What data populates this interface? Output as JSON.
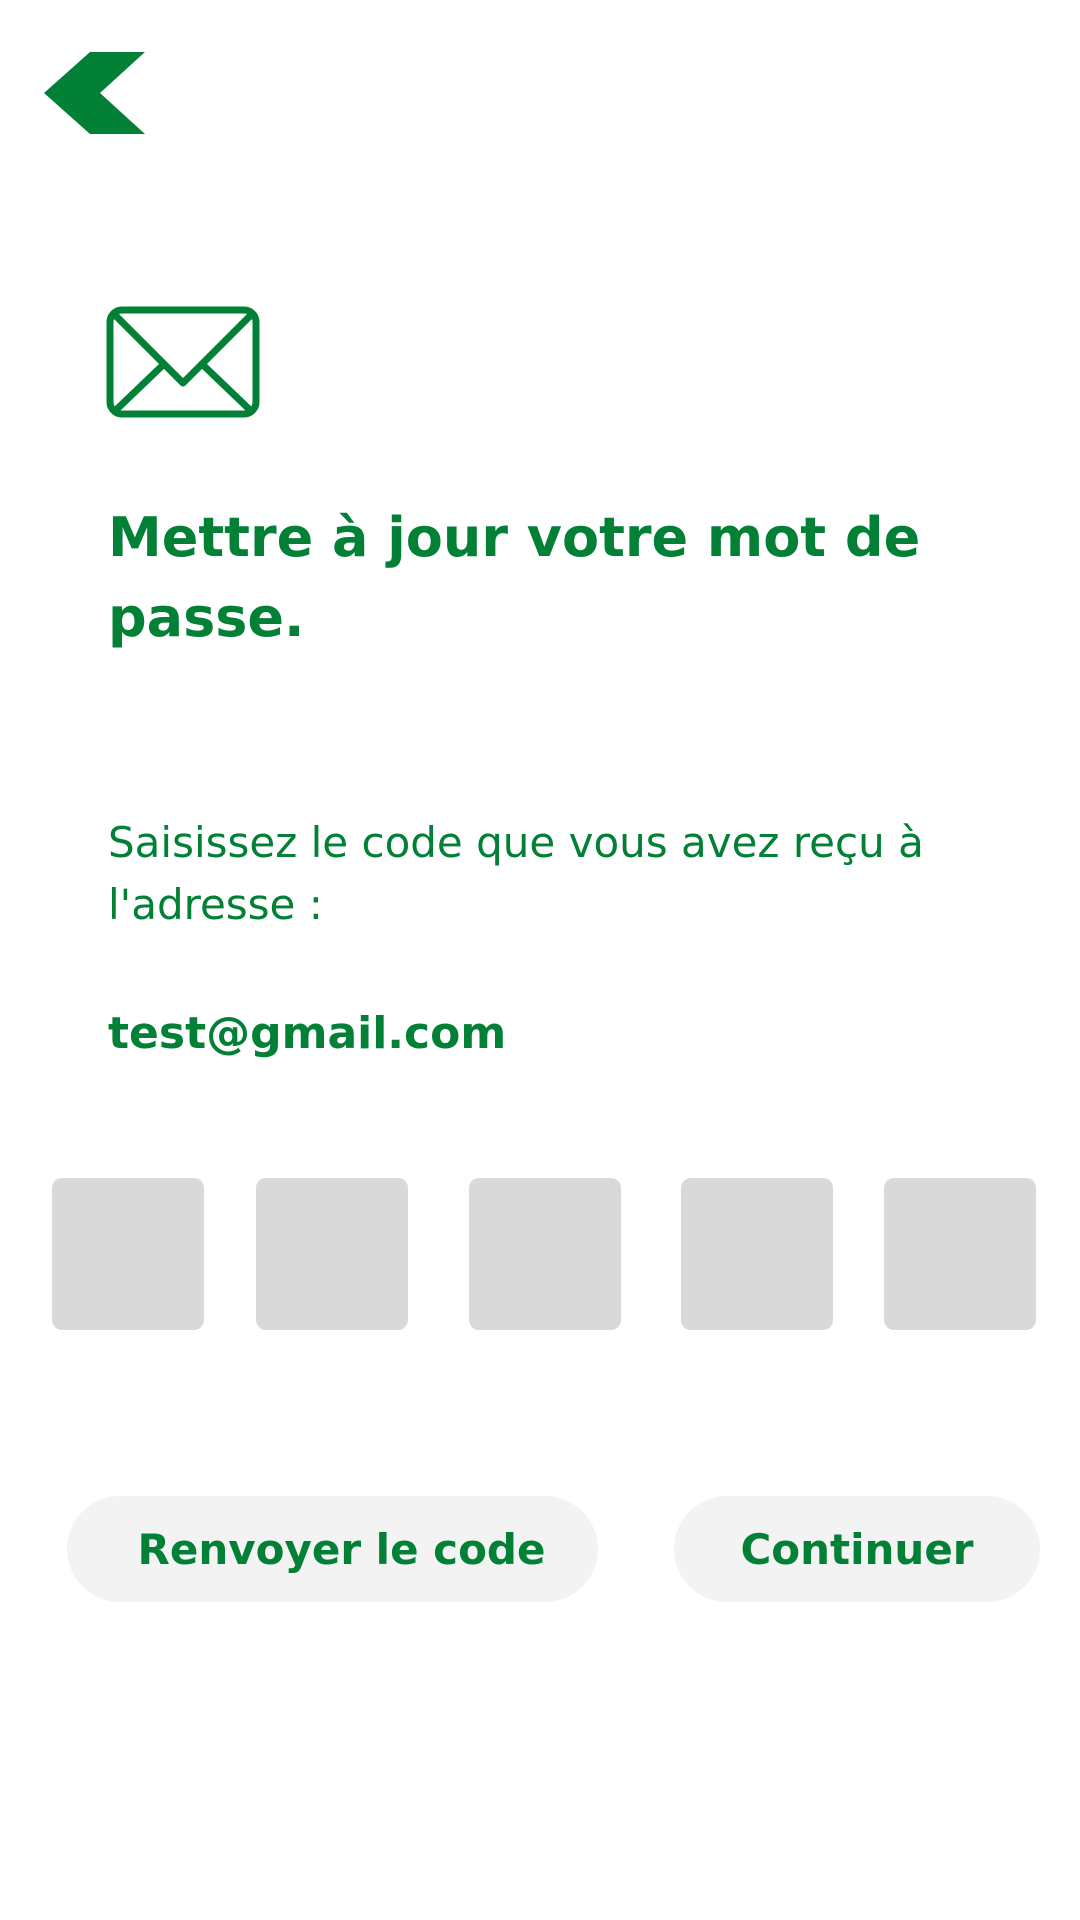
{
  "header": {
    "back_icon": "chevron-left-icon"
  },
  "hero": {
    "icon": "envelope-icon",
    "title": "Mettre à jour votre mot de passe.",
    "instruction": "Saisissez le code que vous avez reçu à l'adresse :",
    "email": "test@gmail.com"
  },
  "code_inputs": [
    {
      "value": ""
    },
    {
      "value": ""
    },
    {
      "value": ""
    },
    {
      "value": ""
    },
    {
      "value": ""
    }
  ],
  "actions": {
    "resend_label": "Renvoyer le code",
    "continue_label": "Continuer"
  },
  "colors": {
    "brand_green": "#028036",
    "code_box_bg": "#d9d9d9",
    "button_bg": "#f3f3f3",
    "background": "#ffffff"
  }
}
